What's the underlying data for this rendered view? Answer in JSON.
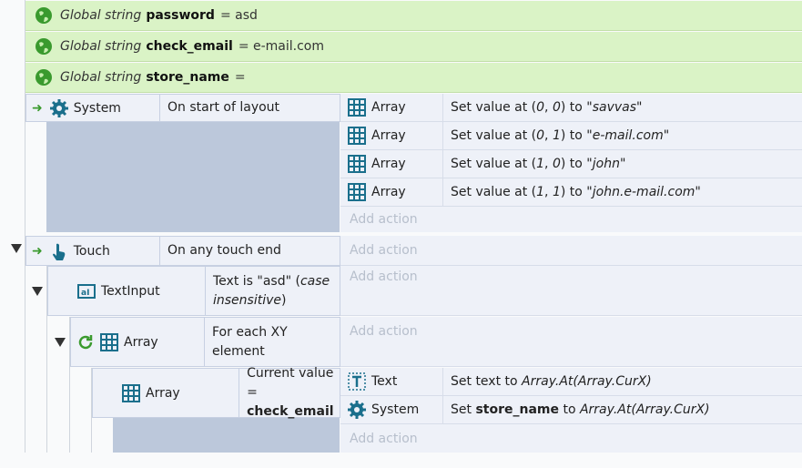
{
  "globals": [
    {
      "prefix": "Global string",
      "name": "password",
      "value": "= asd"
    },
    {
      "prefix": "Global string",
      "name": "check_email",
      "value": "= e-mail.com"
    },
    {
      "prefix": "Global string",
      "name": "store_name",
      "value": "="
    }
  ],
  "event1": {
    "object": "System",
    "condition": "On start of layout",
    "actions": [
      {
        "object": "Array",
        "pre": "Set value at (",
        "a": "0",
        "sep": ", ",
        "b": "0",
        "mid": ") to ",
        "val": "\"savvas\""
      },
      {
        "object": "Array",
        "pre": "Set value at (",
        "a": "0",
        "sep": ", ",
        "b": "1",
        "mid": ") to ",
        "val": "\"e-mail.com\""
      },
      {
        "object": "Array",
        "pre": "Set value at (",
        "a": "1",
        "sep": ", ",
        "b": "0",
        "mid": ") to ",
        "val": "\"john\""
      },
      {
        "object": "Array",
        "pre": "Set value at (",
        "a": "1",
        "sep": ", ",
        "b": "1",
        "mid": ") to ",
        "val": "\"john.e-mail.com\""
      }
    ],
    "add_action": "Add action"
  },
  "event2": {
    "object": "Touch",
    "condition": "On any touch end",
    "add_action": "Add action"
  },
  "event3": {
    "object": "TextInput",
    "cond_pre": "Text is \"asd\" (",
    "cond_italic1": "case",
    "cond_italic2": "insensitive",
    "cond_post": ")",
    "add_action": "Add action"
  },
  "event4": {
    "object": "Array",
    "condition_l1": "For each XY",
    "condition_l2": "element",
    "add_action": "Add action"
  },
  "event5": {
    "object": "Array",
    "condition_l1": "Current value =",
    "condition_l2": "check_email",
    "actions": [
      {
        "object": "Text",
        "pre": "Set text to ",
        "expr": "Array.At(Array.CurX)"
      },
      {
        "object": "System",
        "pre": "Set ",
        "bold": "store_name",
        "mid": " to ",
        "expr": "Array.At(Array.CurX)"
      }
    ],
    "add_action": "Add action"
  },
  "colors": {
    "global_bg": "#daf3c6",
    "event_bg": "#eef1f8",
    "sub_bg": "#bcc8db",
    "accent": "#1a6f8c",
    "green": "#3a9a2e"
  }
}
